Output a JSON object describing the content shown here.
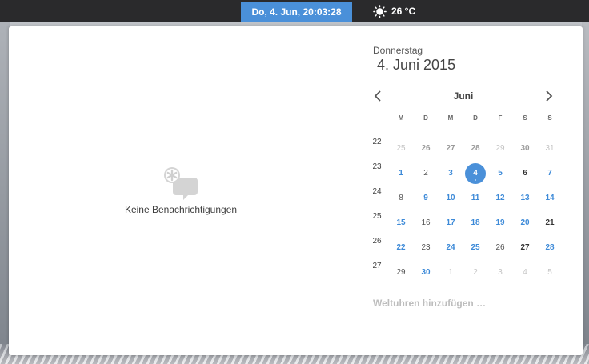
{
  "topbar": {
    "clock": "Do,  4. Jun, 20:03:28",
    "weather_icon": "sun-icon",
    "temperature": "26 °C"
  },
  "notifications": {
    "icon": "notifications-empty-icon",
    "empty_text": "Keine Benachrichtigungen"
  },
  "calendar": {
    "weekday": "Donnerstag",
    "full_date": "4. Juni 2015",
    "month": "Juni",
    "prev_icon": "chevron-left-icon",
    "next_icon": "chevron-right-icon",
    "day_headers": [
      "M",
      "D",
      "M",
      "D",
      "F",
      "S",
      "S"
    ],
    "weeks": [
      {
        "num": "22",
        "days": [
          {
            "d": "25",
            "s": "other"
          },
          {
            "d": "26",
            "s": "other-dark"
          },
          {
            "d": "27",
            "s": "other-dark"
          },
          {
            "d": "28",
            "s": "other-dark"
          },
          {
            "d": "29",
            "s": "other"
          },
          {
            "d": "30",
            "s": "other-dark"
          },
          {
            "d": "31",
            "s": "other"
          }
        ]
      },
      {
        "num": "23",
        "days": [
          {
            "d": "1",
            "s": "hi"
          },
          {
            "d": "2",
            "s": "cur"
          },
          {
            "d": "3",
            "s": "hi"
          },
          {
            "d": "4",
            "s": "sel"
          },
          {
            "d": "5",
            "s": "hi"
          },
          {
            "d": "6",
            "s": "wknd"
          },
          {
            "d": "7",
            "s": "hi"
          }
        ]
      },
      {
        "num": "24",
        "days": [
          {
            "d": "8",
            "s": "cur"
          },
          {
            "d": "9",
            "s": "hi"
          },
          {
            "d": "10",
            "s": "hi"
          },
          {
            "d": "11",
            "s": "hi"
          },
          {
            "d": "12",
            "s": "hi"
          },
          {
            "d": "13",
            "s": "hi"
          },
          {
            "d": "14",
            "s": "hi"
          }
        ]
      },
      {
        "num": "25",
        "days": [
          {
            "d": "15",
            "s": "hi"
          },
          {
            "d": "16",
            "s": "cur"
          },
          {
            "d": "17",
            "s": "hi"
          },
          {
            "d": "18",
            "s": "hi"
          },
          {
            "d": "19",
            "s": "hi"
          },
          {
            "d": "20",
            "s": "hi"
          },
          {
            "d": "21",
            "s": "wknd"
          }
        ]
      },
      {
        "num": "26",
        "days": [
          {
            "d": "22",
            "s": "hi"
          },
          {
            "d": "23",
            "s": "cur"
          },
          {
            "d": "24",
            "s": "hi"
          },
          {
            "d": "25",
            "s": "hi"
          },
          {
            "d": "26",
            "s": "cur"
          },
          {
            "d": "27",
            "s": "wknd"
          },
          {
            "d": "28",
            "s": "hi"
          }
        ]
      },
      {
        "num": "27",
        "days": [
          {
            "d": "29",
            "s": "cur"
          },
          {
            "d": "30",
            "s": "hi"
          },
          {
            "d": "1",
            "s": "other"
          },
          {
            "d": "2",
            "s": "other"
          },
          {
            "d": "3",
            "s": "other"
          },
          {
            "d": "4",
            "s": "other"
          },
          {
            "d": "5",
            "s": "other"
          }
        ]
      }
    ],
    "world_clocks_link": "Weltuhren hinzufügen …"
  },
  "colors": {
    "accent": "#4a90d9",
    "topbar": "#2a2a2c",
    "highlight_day": "#3d8ad8"
  }
}
